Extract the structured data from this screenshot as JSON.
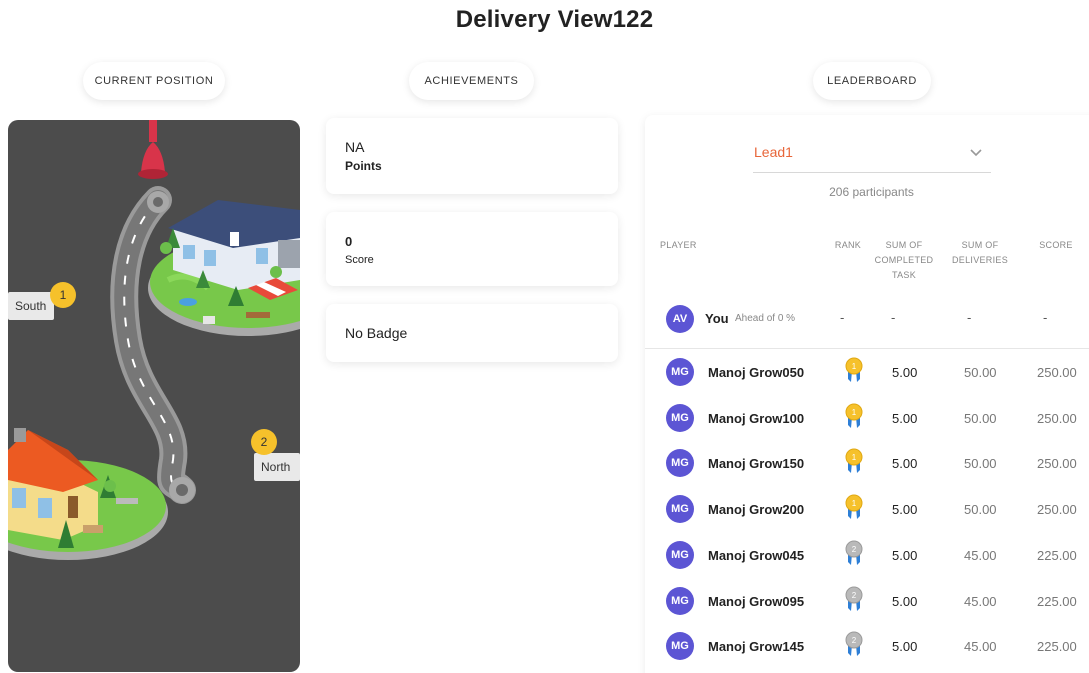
{
  "page": {
    "title": "Delivery View122"
  },
  "tabs": {
    "position": "CURRENT POSITION",
    "achievements": "ACHIEVEMENTS",
    "leaderboard": "LEADERBOARD"
  },
  "map": {
    "markers": [
      {
        "num": "1",
        "label": "South"
      },
      {
        "num": "2",
        "label": "North"
      }
    ]
  },
  "achievements": {
    "points_value": "NA",
    "points_label": "Points",
    "score_value": "0",
    "score_label": "Score",
    "badge_text": "No Badge"
  },
  "leaderboard": {
    "selected": "Lead1",
    "participants": "206 participants",
    "headers": {
      "player": "PLAYER",
      "rank": "RANK",
      "task": "SUM OF COMPLETED TASK",
      "deliveries": "SUM OF DELIVERIES",
      "score": "SCORE"
    },
    "you": {
      "initials": "AV",
      "name": "You",
      "ahead": "Ahead of 0 %",
      "rank": "-",
      "task": "-",
      "deliveries": "-",
      "score": "-"
    },
    "rows": [
      {
        "initials": "MG",
        "name": "Manoj Grow050",
        "medal": "gold",
        "rank": "1",
        "task": "5.00",
        "deliveries": "50.00",
        "score": "250.00"
      },
      {
        "initials": "MG",
        "name": "Manoj Grow100",
        "medal": "gold",
        "rank": "1",
        "task": "5.00",
        "deliveries": "50.00",
        "score": "250.00"
      },
      {
        "initials": "MG",
        "name": "Manoj Grow150",
        "medal": "gold",
        "rank": "1",
        "task": "5.00",
        "deliveries": "50.00",
        "score": "250.00"
      },
      {
        "initials": "MG",
        "name": "Manoj Grow200",
        "medal": "gold",
        "rank": "1",
        "task": "5.00",
        "deliveries": "50.00",
        "score": "250.00"
      },
      {
        "initials": "MG",
        "name": "Manoj Grow045",
        "medal": "silver",
        "rank": "2",
        "task": "5.00",
        "deliveries": "45.00",
        "score": "225.00"
      },
      {
        "initials": "MG",
        "name": "Manoj Grow095",
        "medal": "silver",
        "rank": "2",
        "task": "5.00",
        "deliveries": "45.00",
        "score": "225.00"
      },
      {
        "initials": "MG",
        "name": "Manoj Grow145",
        "medal": "silver",
        "rank": "2",
        "task": "5.00",
        "deliveries": "45.00",
        "score": "225.00"
      }
    ]
  },
  "colors": {
    "accent": "#e8663a",
    "avatar": "#5c55d4",
    "gold": "#f6c12b",
    "silver": "#b9b9b9",
    "ribbon": "#2e7fd6"
  }
}
